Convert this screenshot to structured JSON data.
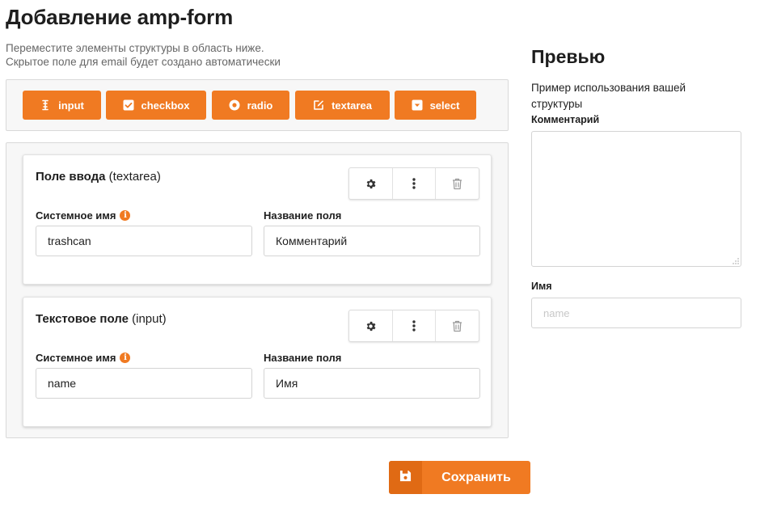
{
  "page": {
    "title": "Добавление amp-form",
    "description_line1": "Переместите элементы структуры в область ниже.",
    "description_line2": "Скрытое поле для email будет создано автоматически"
  },
  "palette": {
    "buttons": [
      {
        "label": "input",
        "icon": "text-cursor-icon"
      },
      {
        "label": "checkbox",
        "icon": "checkbox-icon"
      },
      {
        "label": "radio",
        "icon": "radio-icon"
      },
      {
        "label": "textarea",
        "icon": "edit-icon"
      },
      {
        "label": "select",
        "icon": "select-icon"
      }
    ]
  },
  "structure": {
    "fields": [
      {
        "title": "Поле ввода",
        "type": "(textarea)",
        "system_name_label": "Системное имя",
        "system_name_value": "trashcan",
        "field_name_label": "Название поля",
        "field_name_value": "Комментарий"
      },
      {
        "title": "Текстовое поле",
        "type": "(input)",
        "system_name_label": "Системное имя",
        "system_name_value": "name",
        "field_name_label": "Название поля",
        "field_name_value": "Имя"
      }
    ],
    "card_controls": [
      "gear-icon",
      "more-vertical-icon",
      "trash-icon"
    ]
  },
  "preview": {
    "title": "Превью",
    "description": "Пример использования вашей структуры",
    "comment_label": "Комментарий",
    "name_label": "Имя",
    "name_placeholder": "name"
  },
  "actions": {
    "save_label": "Сохранить"
  },
  "colors": {
    "accent": "#f07a22",
    "accent_dark": "#e06a14",
    "panel_bg": "#f7f7f7",
    "border": "#d9d9d9"
  }
}
